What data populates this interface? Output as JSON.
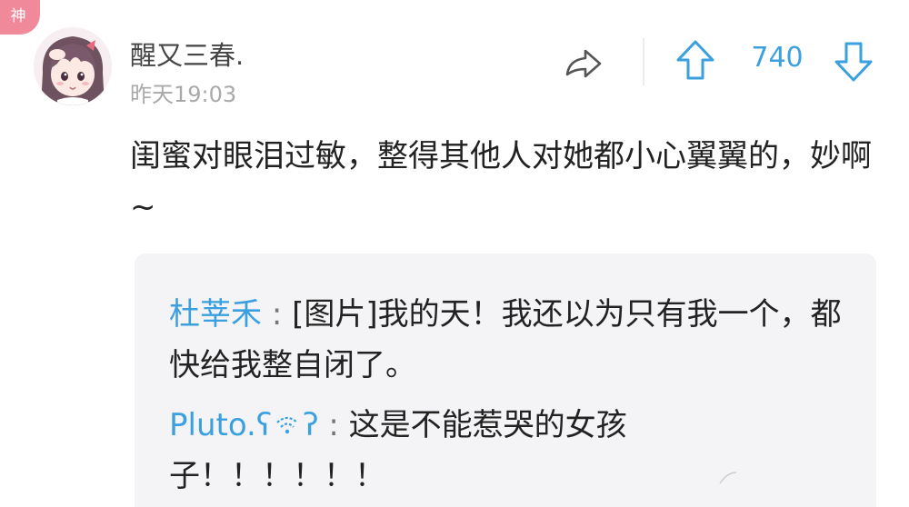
{
  "badge": {
    "label": "神",
    "color": "#f08a9a"
  },
  "comment": {
    "username": "醒又三春.",
    "timestamp": "昨天19:03",
    "vote_count": "740",
    "text": "闺蜜对眼泪过敏，整得其他人对她都小心翼翼的，妙啊~",
    "accent_color": "#3aa0e0"
  },
  "icons": {
    "share": "share-arrow-icon",
    "upvote": "arrow-up-icon",
    "downvote": "arrow-down-icon",
    "avatar": "anime-girl-avatar"
  },
  "replies": [
    {
      "author": "杜莘禾",
      "separator": ":",
      "text": "[图片]我的天！我还以为只有我一个，都快给我整自闭了。"
    },
    {
      "author": "Pluto.ʕ",
      "author_suffix": "ʔ",
      "separator": ":",
      "text": "这是不能惹哭的女孩子！！！！！！"
    }
  ]
}
